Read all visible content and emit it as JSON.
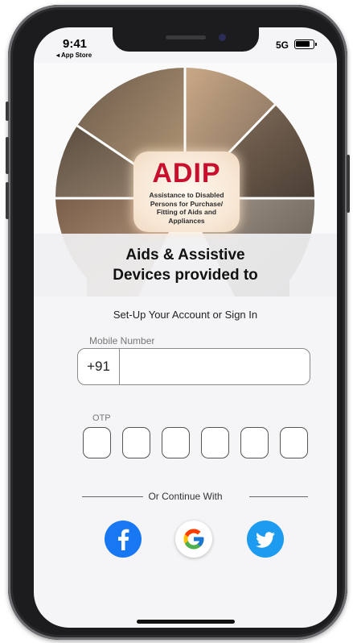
{
  "status_bar": {
    "time": "9:41",
    "back_label": "◂ App Store",
    "network": "5G"
  },
  "banner": {
    "logo_text": "ADIP",
    "logo_subtitle": "Assistance to Disabled Persons for Purchase/ Fitting of Aids and Appliances",
    "heading_line1": "Aids & Assistive",
    "heading_line2": "Devices provided to"
  },
  "form": {
    "title": "Set-Up Your Account or Sign In",
    "mobile_label": "Mobile Number",
    "country_code": "+91",
    "mobile_value": "",
    "otp_label": "OTP",
    "otp_values": [
      "",
      "",
      "",
      "",
      "",
      ""
    ]
  },
  "social": {
    "divider_text": "Or Continue With",
    "icons": [
      "facebook-icon",
      "google-icon",
      "twitter-icon"
    ]
  },
  "colors": {
    "adip_red": "#c8102e",
    "facebook": "#1877f2",
    "twitter": "#1d9bf0",
    "screen_bg": "#f5f5f7"
  }
}
